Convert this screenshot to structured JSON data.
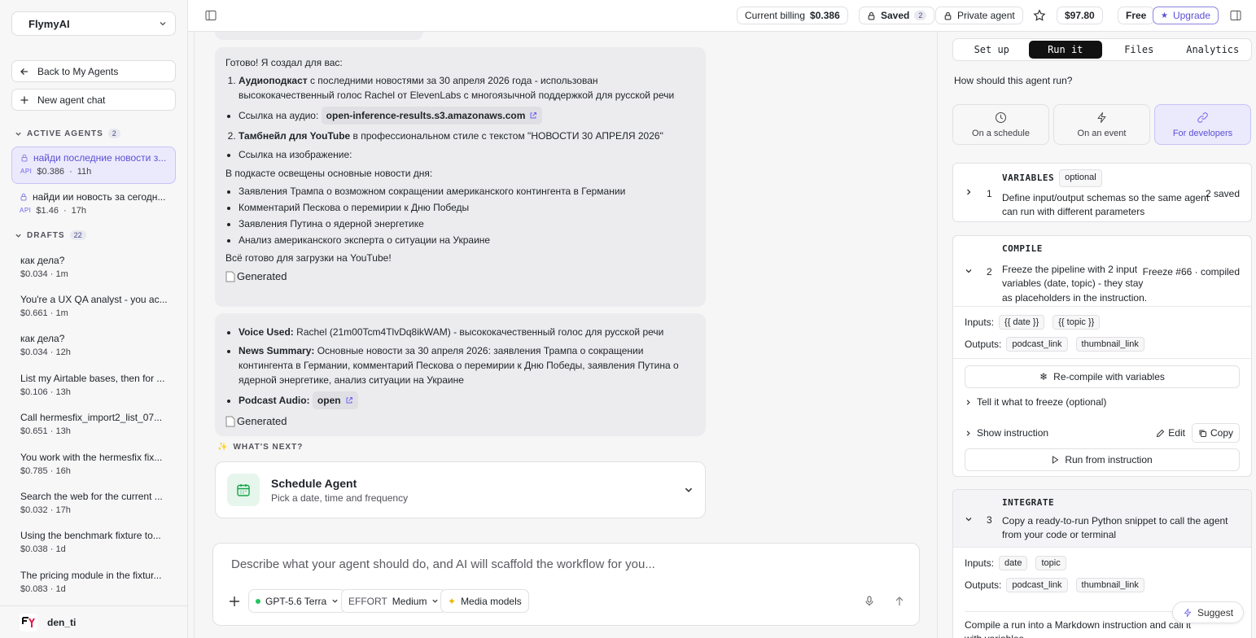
{
  "sidebar": {
    "workspace": "FlymyAI",
    "back_label": "Back to My Agents",
    "new_chat_label": "New agent chat",
    "active_title": "ACTIVE AGENTS",
    "active_count": "2",
    "active_agents": [
      {
        "title": "найди последние новости з...",
        "badge": "API",
        "cost": "$0.386",
        "age": "11h"
      },
      {
        "title": "найди ии новость за сегодн...",
        "badge": "API",
        "cost": "$1.46",
        "age": "17h"
      }
    ],
    "drafts_title": "DRAFTS",
    "drafts_count": "22",
    "drafts": [
      {
        "title": "как дела?",
        "cost": "$0.034",
        "age": "1m"
      },
      {
        "title": "You're a UX QA analyst - you ac...",
        "cost": "$0.661",
        "age": "1m"
      },
      {
        "title": "как дела?",
        "cost": "$0.034",
        "age": "12h"
      },
      {
        "title": "List my Airtable bases, then for ...",
        "cost": "$0.106",
        "age": "13h"
      },
      {
        "title": "Call hermesfix_import2_list_07...",
        "cost": "$0.651",
        "age": "13h"
      },
      {
        "title": "You work with the hermesfix fix...",
        "cost": "$0.785",
        "age": "16h"
      },
      {
        "title": "Search the web for the current ...",
        "cost": "$0.032",
        "age": "17h"
      },
      {
        "title": "Using the benchmark fixture to...",
        "cost": "$0.038",
        "age": "1d"
      },
      {
        "title": "The pricing module in the fixtur...",
        "cost": "$0.083",
        "age": "1d"
      }
    ],
    "user_name": "den_ti",
    "sep": "·"
  },
  "topbar": {
    "billing_label": "Current billing",
    "billing_value": "$0.386",
    "saved_label": "Saved",
    "saved_count": "2",
    "private_label": "Private agent",
    "balance": "$97.80",
    "plan": "Free",
    "upgrade_label": "Upgrade"
  },
  "chat": {
    "msg1": {
      "intro": "Готово! Я создал для вас:",
      "item1_bold": "Аудиоподкаст",
      "item1_text": " с последними новостями за 30 апреля 2026 года - использован высококачественный голос Rachel от ElevenLabs с многоязычной поддержкой для русской речи",
      "audio_link_label": "Ссылка на аудио:",
      "audio_link": "open-inference-results.s3.amazonaws.com",
      "item2_bold": "Тамбнейл для YouTube",
      "item2_text": " в профессиональном стиле с текстом \"НОВОСТИ 30 АПРЕЛЯ 2026\"",
      "image_link_label": "Ссылка на изображение:",
      "covered": "В подкасте освещены основные новости дня:",
      "news": [
        "Заявления Трампа о возможном сокращении американского контингента в Германии",
        "Комментарий Пескова о перемирии к Дню Победы",
        "Заявления Путина о ядерной энергетике",
        "Анализ американского эксперта о ситуации на Украине"
      ],
      "ready": "Всё готово для загрузки на YouTube!",
      "img_alt": "Generated"
    },
    "msg2": {
      "voice_bold": "Voice Used:",
      "voice_text": " Rachel (21m00Tcm4TlvDq8ikWAM) - высококачественный голос для русской речи",
      "summary_bold": "News Summary:",
      "summary_text": " Основные новости за 30 апреля 2026: заявления Трампа о сокращении контингента в Германии, комментарий Пескова о перемирии к Дню Победы, заявления Путина о ядерной энергетике, анализ ситуации на Украине",
      "podcast_bold": "Podcast Audio:",
      "podcast_link": "open",
      "img_alt": "Generated"
    },
    "whats_next": "WHAT'S NEXT?",
    "schedule_title": "Schedule Agent",
    "schedule_sub": "Pick a date, time and frequency",
    "composer_placeholder": "Describe what your agent should do, and AI will scaffold the workflow for you...",
    "model": "GPT-5.6 Terra",
    "effort_label": "EFFORT",
    "effort_value": "Medium",
    "media_label": "Media models"
  },
  "panel": {
    "tabs": [
      "Set up",
      "Run it",
      "Files",
      "Analytics"
    ],
    "question": "How should this agent run?",
    "modes": [
      "On a schedule",
      "On an event",
      "For developers"
    ],
    "variables": {
      "num": "1",
      "title": "VARIABLES",
      "tag": "optional",
      "desc": "Define input/output schemas so the same agent can run with different parameters",
      "status": "2 saved"
    },
    "compile": {
      "num": "2",
      "title": "COMPILE",
      "desc": "Freeze the pipeline with 2 input variables (date, topic) - they stay as placeholders in the instruction.",
      "status": "Freeze #66 · compiled"
    },
    "inputs_label": "Inputs:",
    "outputs_label": "Outputs:",
    "compile_inputs": [
      "{{ date }}",
      "{{ topic }}"
    ],
    "compile_outputs": [
      "podcast_link",
      "thumbnail_link"
    ],
    "recompile": "Re-compile with variables",
    "freeze_hint": "Tell it what to freeze (optional)",
    "show_instruction": "Show instruction",
    "edit": "Edit",
    "copy": "Copy",
    "run_from": "Run from instruction",
    "integrate": {
      "num": "3",
      "title": "INTEGRATE",
      "desc": "Copy a ready-to-run Python snippet to call the agent from your code or terminal"
    },
    "int_inputs": [
      "date",
      "topic"
    ],
    "int_outputs": [
      "podcast_link",
      "thumbnail_link"
    ],
    "bottom_text": "Compile a run into a Markdown instruction and call it with variables.",
    "suggest": "Suggest"
  },
  "colors": {
    "accent": "#5b4fd6",
    "accent_bg": "#ebeafc",
    "dark": "#111111",
    "green_bg": "#e6f6ec",
    "green": "#16a34a"
  }
}
